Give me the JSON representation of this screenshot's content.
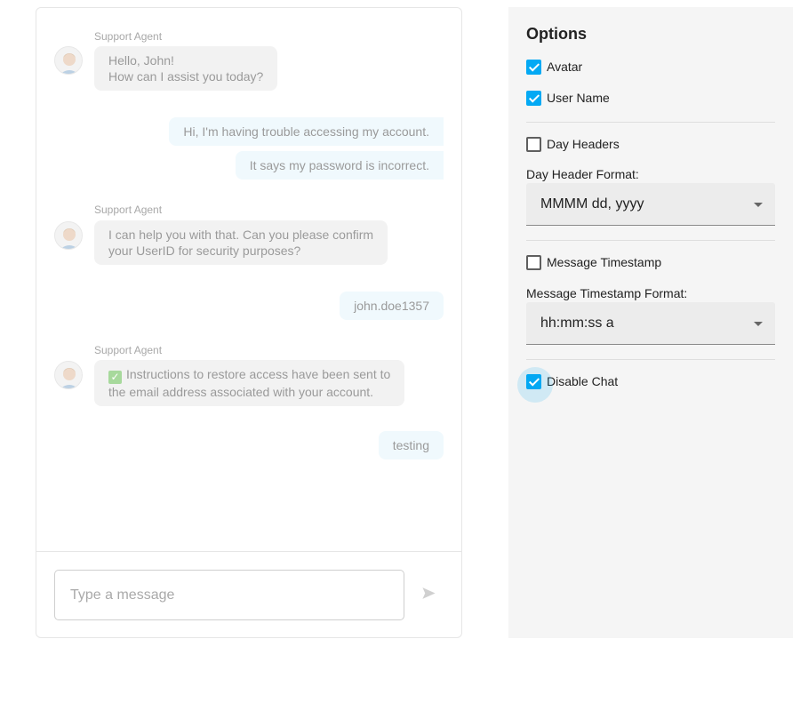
{
  "chat": {
    "messages": [
      {
        "direction": "in",
        "author": "Support Agent",
        "lines": [
          "Hello, John!",
          "How can I assist you today?"
        ]
      },
      {
        "direction": "out",
        "text": "Hi, I'm having trouble accessing my account."
      },
      {
        "direction": "out",
        "text": "It says my password is incorrect."
      },
      {
        "direction": "in",
        "author": "Support Agent",
        "lines": [
          "I can help you with that. Can you please confirm",
          "your UserID for security purposes?"
        ]
      },
      {
        "direction": "out",
        "text": "john.doe1357"
      },
      {
        "direction": "in",
        "author": "Support Agent",
        "emoji": "check-mark-emoji",
        "lines": [
          "Instructions to restore access have been sent to",
          "the email address associated with your account."
        ]
      },
      {
        "direction": "out",
        "text": "testing"
      }
    ],
    "input": {
      "placeholder": "Type a message",
      "value": ""
    },
    "send_icon": "send-icon",
    "disabled": true
  },
  "options": {
    "title": "Options",
    "avatar": {
      "label": "Avatar",
      "checked": true
    },
    "user_name": {
      "label": "User Name",
      "checked": true
    },
    "day_headers": {
      "label": "Day Headers",
      "checked": false
    },
    "day_header_format": {
      "label": "Day Header Format:",
      "value": "MMMM dd, yyyy"
    },
    "message_timestamp": {
      "label": "Message Timestamp",
      "checked": false
    },
    "message_timestamp_format": {
      "label": "Message Timestamp Format:",
      "value": "hh:mm:ss a"
    },
    "disable_chat": {
      "label": "Disable Chat",
      "checked": true,
      "focused": true
    }
  },
  "colors": {
    "accent": "#03a9f4",
    "outgoing_bubble": "#f0f9fd",
    "incoming_bubble": "#f2f2f2",
    "options_background": "#f5f5f5"
  }
}
